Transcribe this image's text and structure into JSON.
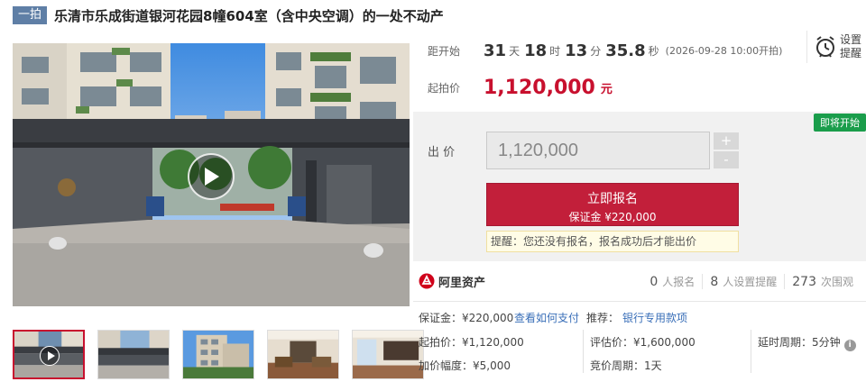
{
  "header": {
    "badge": "一拍",
    "title": "乐清市乐成街道银河花园8幢604室（含中央空调）的一处不动产"
  },
  "media": {
    "main": {
      "type": "video",
      "icon": "play-icon"
    },
    "thumbnails": [
      {
        "kind": "video",
        "selected": true
      },
      {
        "kind": "photo",
        "selected": false
      },
      {
        "kind": "photo",
        "selected": false
      },
      {
        "kind": "photo",
        "selected": false
      },
      {
        "kind": "photo",
        "selected": false
      }
    ]
  },
  "countdown": {
    "label": "距开始",
    "days": "31",
    "days_unit": "天",
    "hours": "18",
    "hours_unit": "时",
    "minutes": "13",
    "minutes_unit": "分",
    "seconds": "35.8",
    "seconds_unit": "秒",
    "start_note": "(2026-09-28 10:00开拍)"
  },
  "remind": {
    "line1": "设置",
    "line2": "提醒",
    "icon": "alarm-clock-icon"
  },
  "start_price": {
    "label": "起拍价",
    "value": "1,120,000",
    "unit": "元"
  },
  "bid": {
    "status_tag": "即将开始",
    "label": "出 价",
    "input_value": "1,120,000",
    "plus": "+",
    "minus": "-",
    "signup_label": "立即报名",
    "signup_deposit": "保证金 ¥220,000",
    "tip": "提醒：您还没有报名，报名成功后才能出价"
  },
  "platform": {
    "name": "阿里资产",
    "icon": "ali-asset-logo-icon"
  },
  "stats": [
    {
      "num": "0",
      "label": "人报名"
    },
    {
      "num": "8",
      "label": "人设置提醒"
    },
    {
      "num": "273",
      "label": "次围观"
    }
  ],
  "details": {
    "deposit": "保证金：¥220,000",
    "how_to_pay": "查看如何支付",
    "recommend_label": "推荐：",
    "recommend_link": "银行专用款项",
    "start_price": "起拍价：¥1,120,000",
    "appraisal": "评估价：¥1,600,000",
    "delay_cycle": "延时周期：5分钟",
    "increment": "加价幅度：¥5,000",
    "bid_cycle": "竞价周期：1天"
  },
  "colors": {
    "accent_red": "#c8102e",
    "badge_blue": "#5f7fa6",
    "status_green": "#1a9d4b",
    "link_blue": "#3a6fb8"
  }
}
